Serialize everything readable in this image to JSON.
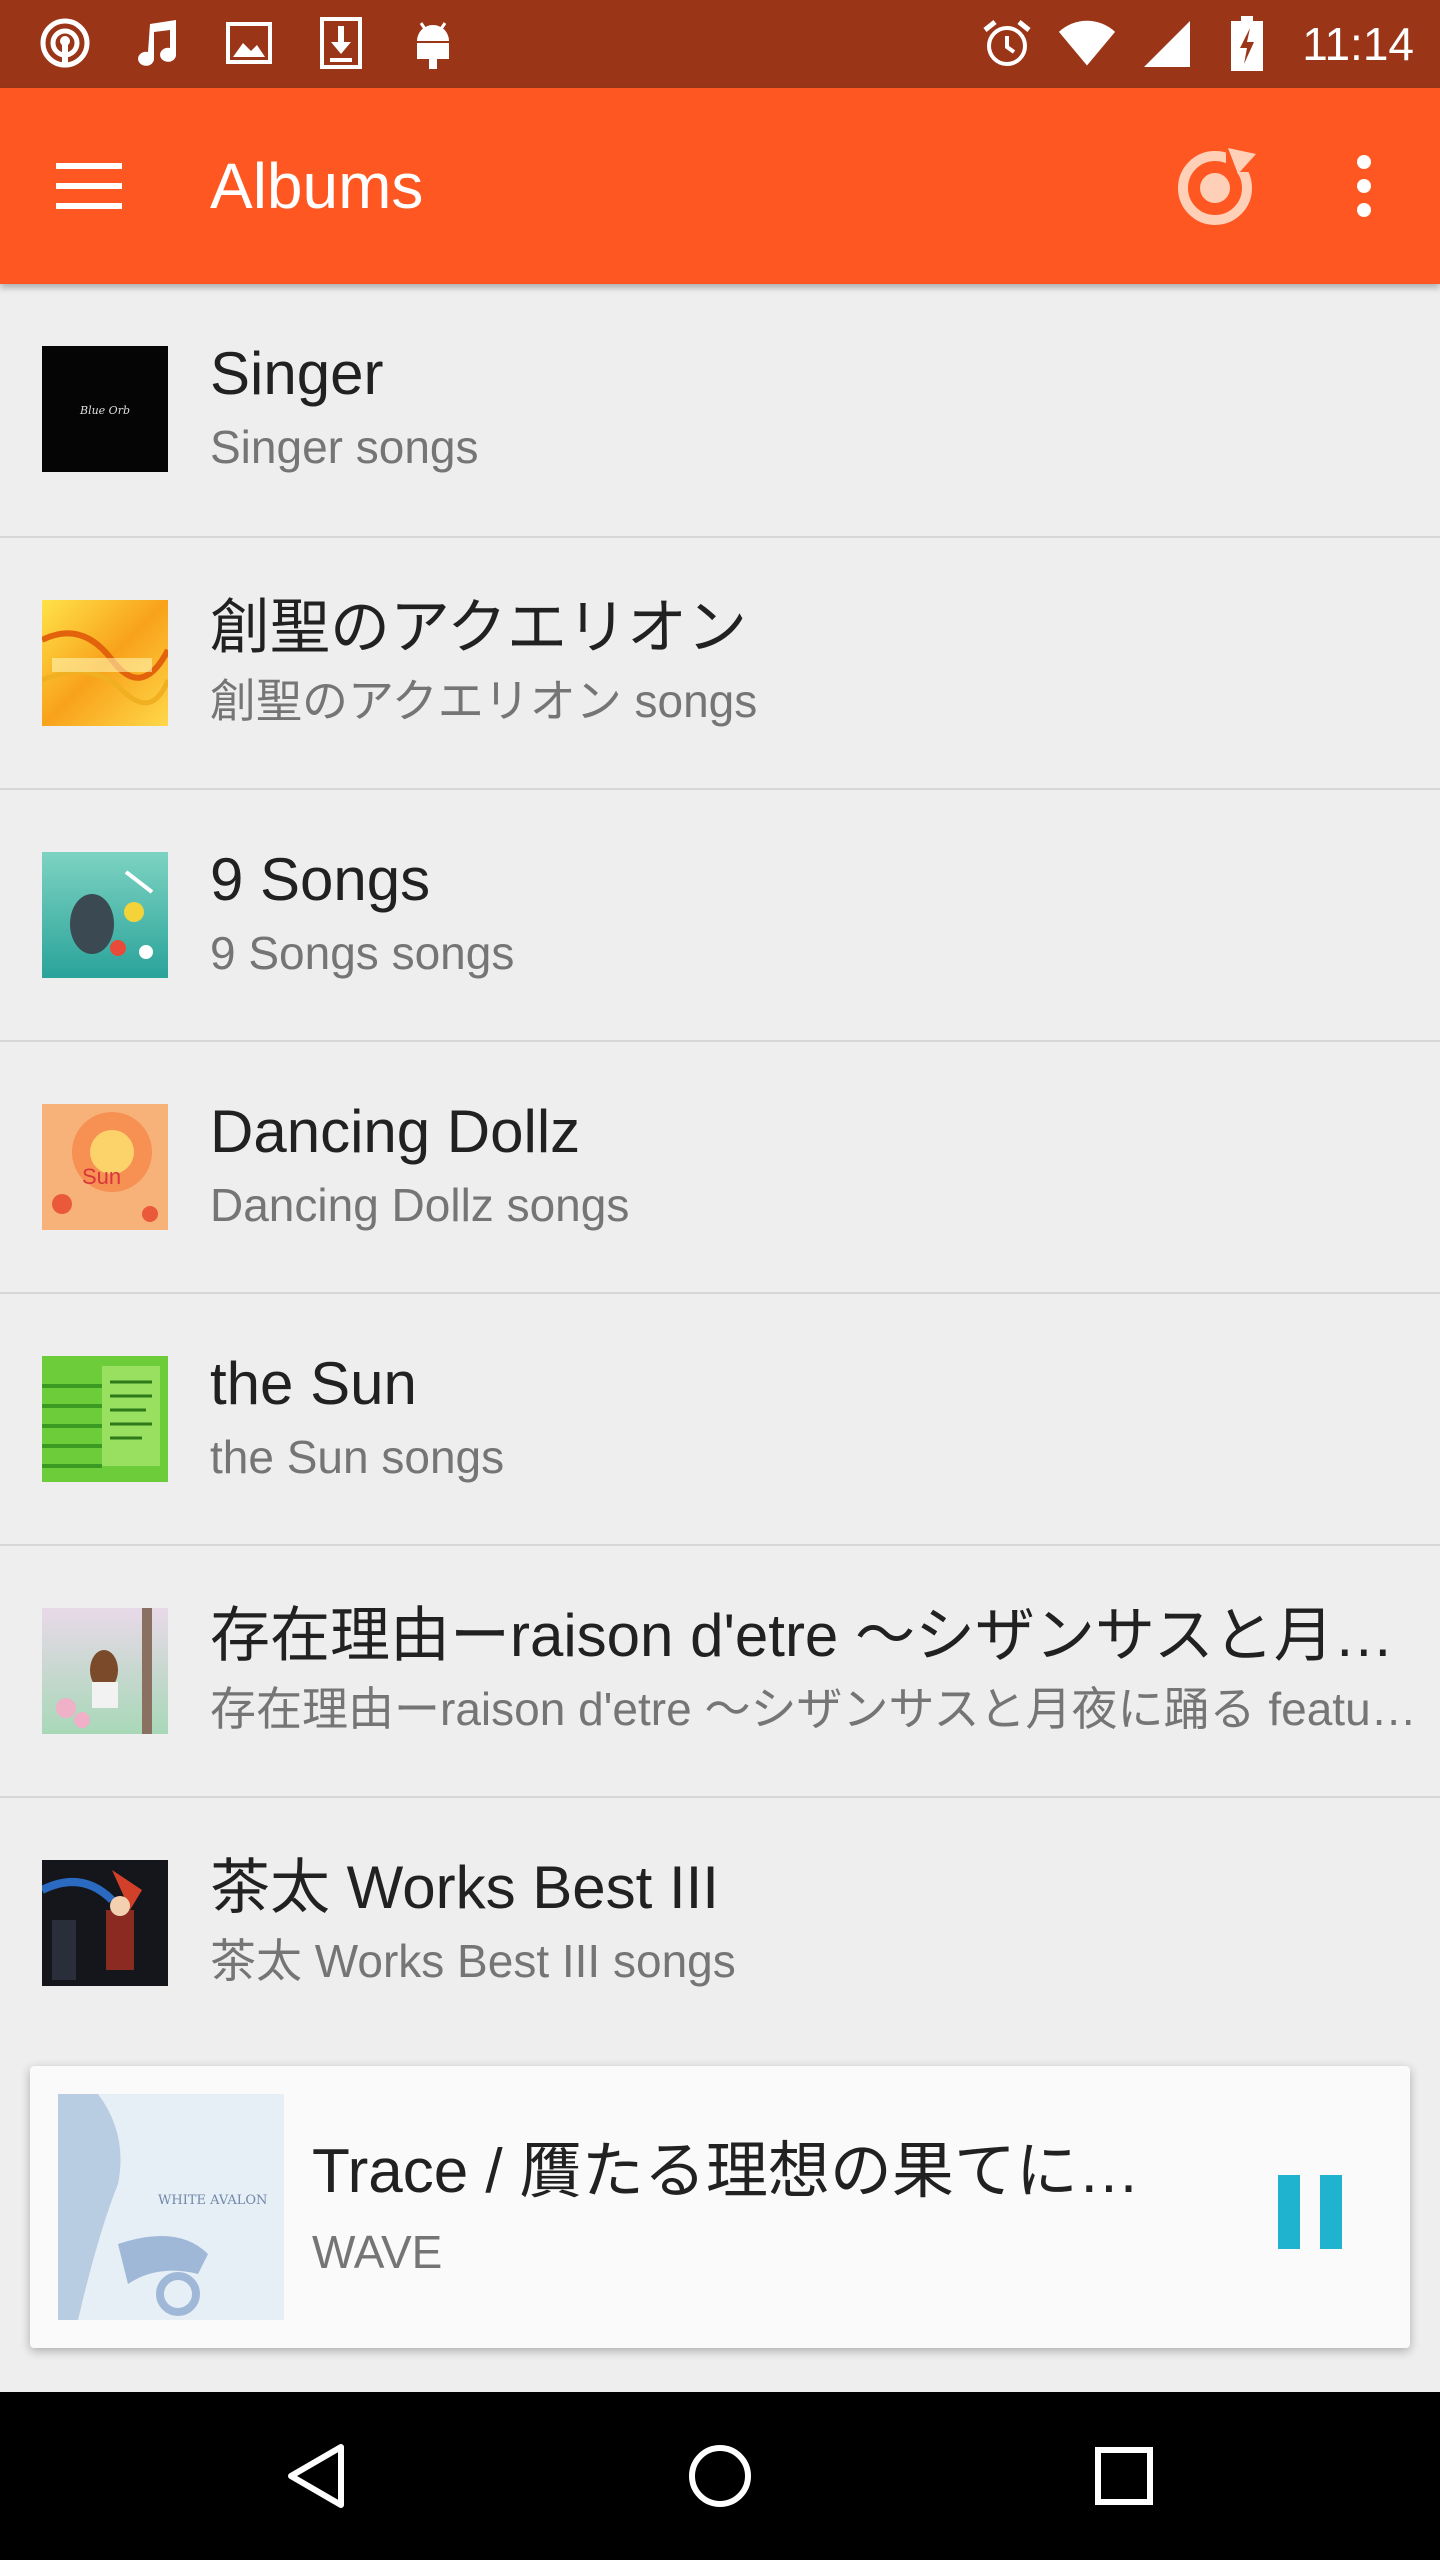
{
  "status_bar": {
    "time": "11:14",
    "left_icons": [
      "podcast-icon",
      "music-note-icon",
      "image-icon",
      "download-icon",
      "android-icon"
    ],
    "right_icons": [
      "alarm-icon",
      "wifi-icon",
      "signal-icon",
      "battery-charging-icon"
    ]
  },
  "toolbar": {
    "title": "Albums",
    "color": "#ff5722"
  },
  "albums": [
    {
      "title": "Singer",
      "subtitle": "Singer songs",
      "art_text": "Blue Orb"
    },
    {
      "title": "創聖のアクエリオン",
      "subtitle": "創聖のアクエリオン songs"
    },
    {
      "title": "9 Songs",
      "subtitle": "9 Songs songs"
    },
    {
      "title": "Dancing Dollz",
      "subtitle": "Dancing Dollz songs",
      "art_text": "Sun"
    },
    {
      "title": "the Sun",
      "subtitle": "the Sun songs"
    },
    {
      "title": "存在理由ーraison d'etre 〜シザンサスと月夜に踊る featuring Alitty〜",
      "subtitle": "存在理由ーraison d'etre 〜シザンサスと月夜に踊る featuring Alitty〜 songs"
    },
    {
      "title": "茶太 Works Best III",
      "subtitle": "茶太 Works Best III songs"
    }
  ],
  "now_playing": {
    "title": "Trace / 贋たる理想の果てに…",
    "subtitle": "WAVE",
    "art_text": "WHITE AVALON",
    "accent": "#1fb3cf"
  }
}
